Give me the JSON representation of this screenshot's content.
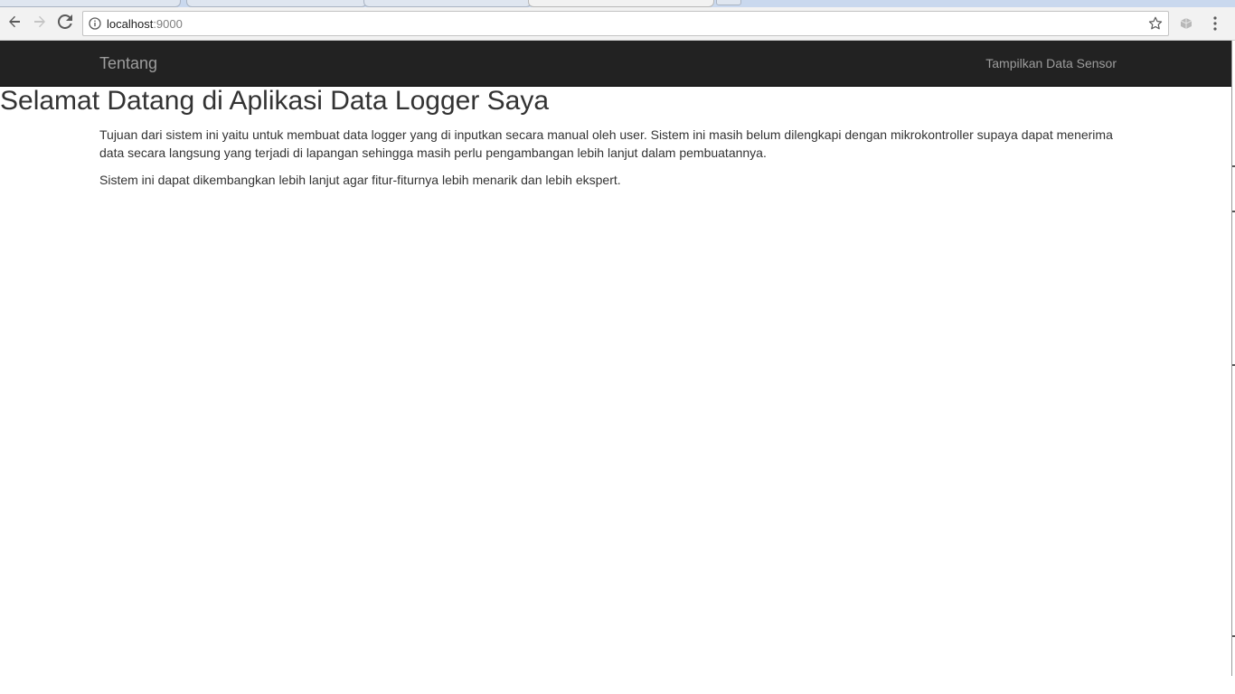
{
  "browser": {
    "url_host": "localhost",
    "url_port": ":9000"
  },
  "navbar": {
    "brand": "Tentang",
    "link": "Tampilkan Data Sensor"
  },
  "page": {
    "title": "Selamat Datang di Aplikasi Data Logger Saya",
    "paragraphs": [
      "Tujuan dari sistem ini yaitu untuk membuat data logger yang di inputkan secara manual oleh user. Sistem ini masih belum dilengkapi dengan mikrokontroller supaya dapat menerima data secara langsung yang terjadi di lapangan sehingga masih perlu pengambangan lebih lanjut dalam pembuatannya.",
      "Sistem ini dapat dikembangkan lebih lanjut agar fitur-fiturnya lebih menarik dan lebih ekspert."
    ]
  },
  "colors": {
    "navbar_bg": "#222222",
    "navbar_text": "#9d9d9d",
    "body_text": "#333333"
  },
  "icons": {
    "back": "arrow-left-icon",
    "forward": "arrow-right-icon",
    "reload": "reload-icon",
    "info": "info-icon",
    "bookmark": "star-icon",
    "extension": "extension-icon",
    "menu": "more-vertical-icon"
  }
}
